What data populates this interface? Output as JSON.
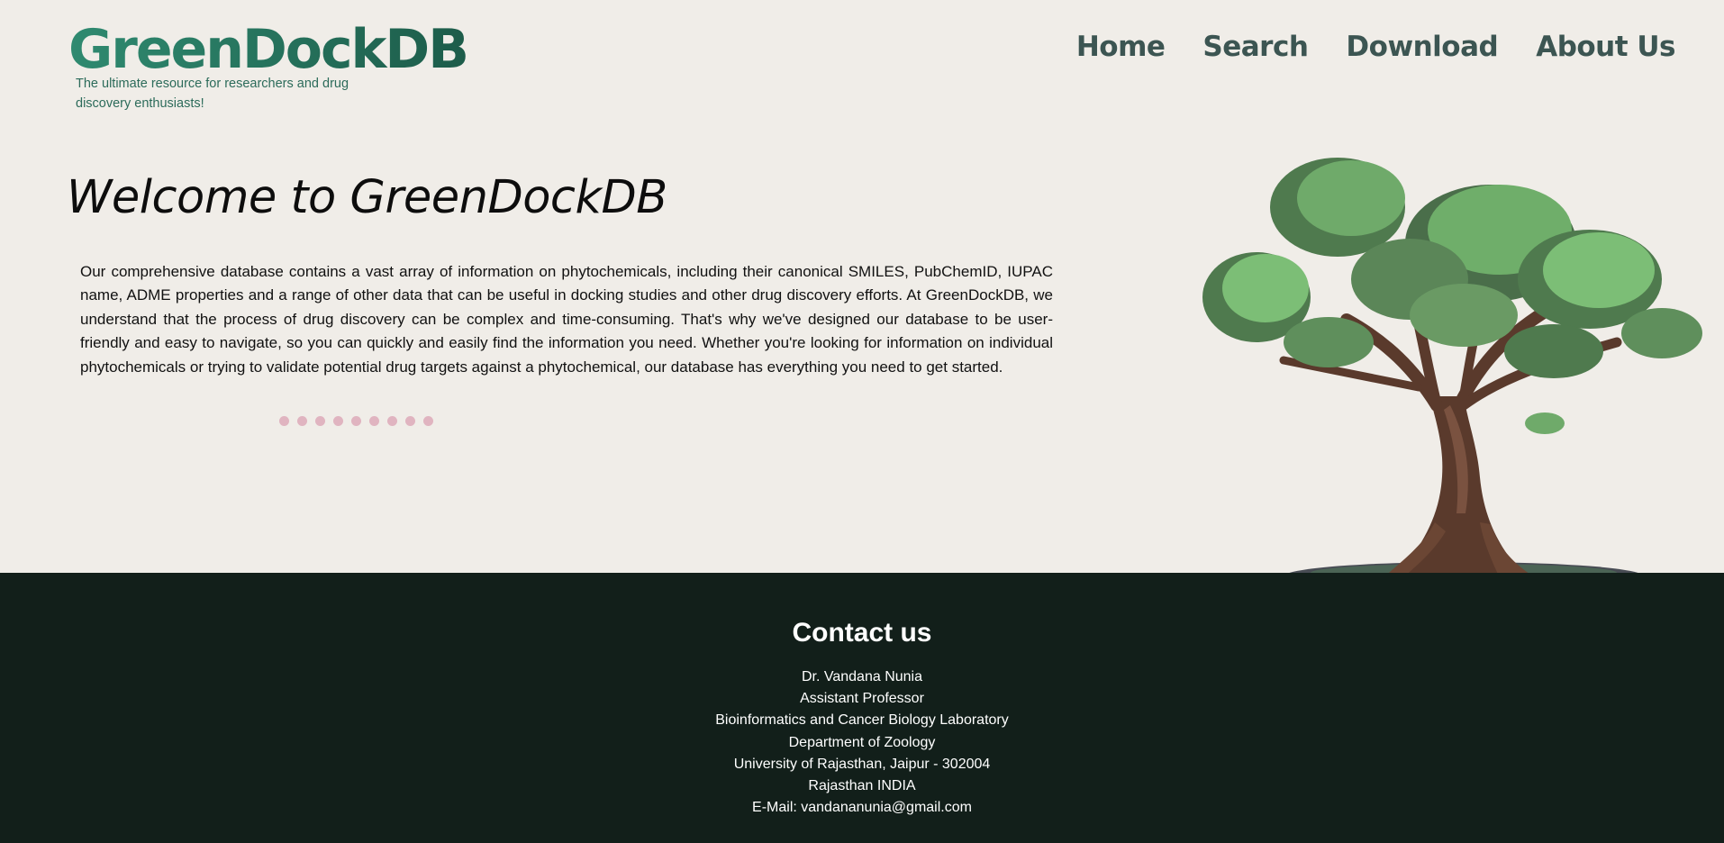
{
  "header": {
    "logo": "GreenDockDB",
    "tagline": "The ultimate resource for researchers and drug discovery enthusiasts!"
  },
  "nav": {
    "items": [
      {
        "label": "Home"
      },
      {
        "label": "Search"
      },
      {
        "label": "Download"
      },
      {
        "label": "About Us"
      }
    ]
  },
  "hero": {
    "title": "Welcome to GreenDockDB",
    "description": "Our comprehensive database contains a vast array of information on phytochemicals, including their canonical SMILES, PubChemID, IUPAC name, ADME properties and a range of other data that can be useful in docking studies and other drug discovery efforts. At GreenDockDB, we understand that the process of drug discovery can be complex and time-consuming. That's why we've designed our database to be user-friendly and easy to navigate, so you can quickly and easily find the information you need. Whether you're looking for information on individual phytochemicals or trying to validate potential drug targets against a phytochemical, our database has everything you need to get started.",
    "carousel_dot_count": 9,
    "image": "tree-illustration"
  },
  "footer": {
    "heading": "Contact us",
    "lines": [
      "Dr. Vandana Nunia",
      "Assistant Professor",
      "Bioinformatics and Cancer Biology Laboratory",
      "Department of Zoology",
      "University of Rajasthan, Jaipur - 302004",
      "Rajasthan INDIA",
      "E-Mail: vandananunia@gmail.com"
    ]
  },
  "colors": {
    "background": "#f0ede8",
    "logo": "#2b7a63",
    "nav": "#3c5552",
    "footer": "#121f1a",
    "dots": "#e0b4c0"
  }
}
